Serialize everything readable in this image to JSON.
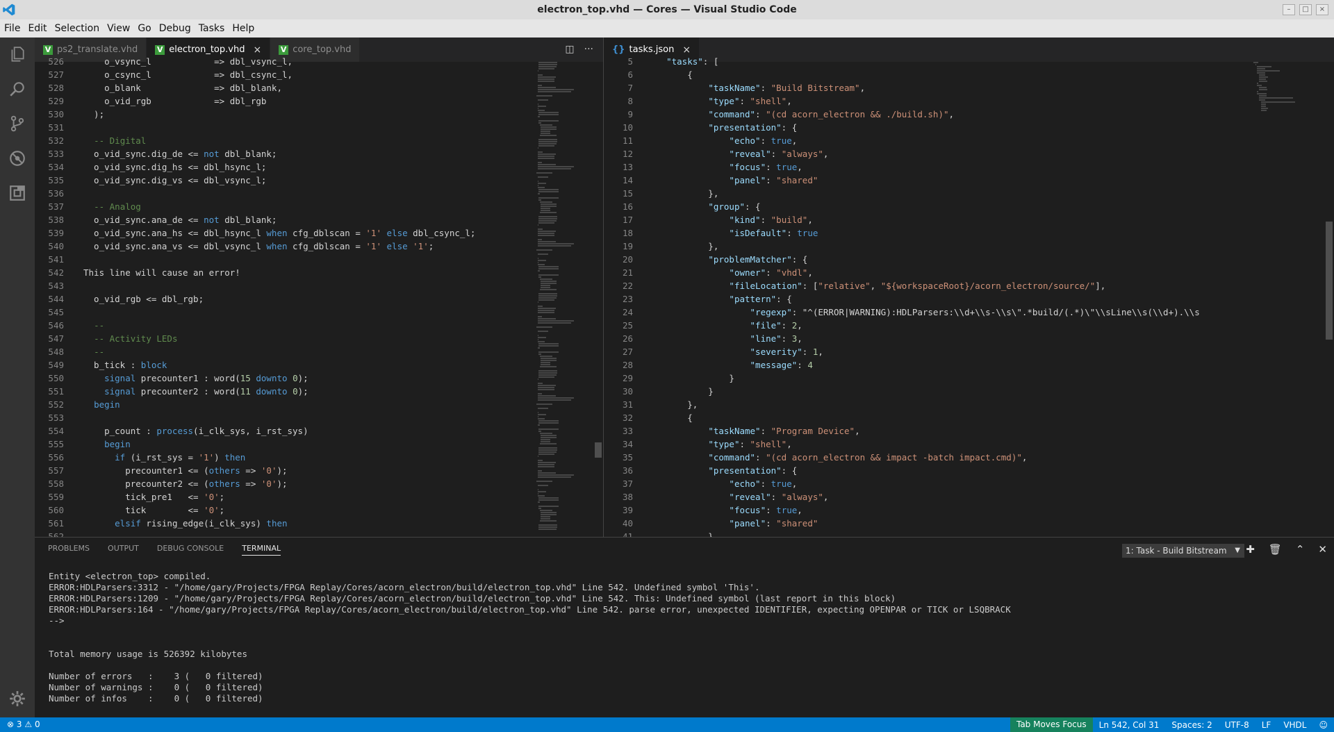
{
  "window": {
    "title": "electron_top.vhd — Cores — Visual Studio Code"
  },
  "menu": [
    "File",
    "Edit",
    "Selection",
    "View",
    "Go",
    "Debug",
    "Tasks",
    "Help"
  ],
  "activity": [
    "files-icon",
    "search-icon",
    "source-control-icon",
    "debug-icon",
    "extensions-icon"
  ],
  "left_group": {
    "tabs": [
      {
        "label": "ps2_translate.vhd",
        "active": false
      },
      {
        "label": "electron_top.vhd",
        "active": true
      },
      {
        "label": "core_top.vhd",
        "active": false
      }
    ],
    "lines": [
      {
        "n": "526",
        "t": "    o_vsync_l            => dbl_vsync_l,"
      },
      {
        "n": "527",
        "t": "    o_csync_l            => dbl_csync_l,"
      },
      {
        "n": "528",
        "t": "    o_blank              => dbl_blank,"
      },
      {
        "n": "529",
        "t": "    o_vid_rgb            => dbl_rgb"
      },
      {
        "n": "530",
        "t": "  );"
      },
      {
        "n": "531",
        "t": ""
      },
      {
        "n": "532",
        "t": "  -- Digital"
      },
      {
        "n": "533",
        "t": "  o_vid_sync.dig_de <= not dbl_blank;"
      },
      {
        "n": "534",
        "t": "  o_vid_sync.dig_hs <= dbl_hsync_l;"
      },
      {
        "n": "535",
        "t": "  o_vid_sync.dig_vs <= dbl_vsync_l;"
      },
      {
        "n": "536",
        "t": ""
      },
      {
        "n": "537",
        "t": "  -- Analog"
      },
      {
        "n": "538",
        "t": "  o_vid_sync.ana_de <= not dbl_blank;"
      },
      {
        "n": "539",
        "t": "  o_vid_sync.ana_hs <= dbl_hsync_l when cfg_dblscan = '1' else dbl_csync_l;"
      },
      {
        "n": "540",
        "t": "  o_vid_sync.ana_vs <= dbl_vsync_l when cfg_dblscan = '1' else '1';"
      },
      {
        "n": "541",
        "t": ""
      },
      {
        "n": "542",
        "t": "This line will cause an error!"
      },
      {
        "n": "543",
        "t": ""
      },
      {
        "n": "544",
        "t": "  o_vid_rgb <= dbl_rgb;"
      },
      {
        "n": "545",
        "t": ""
      },
      {
        "n": "546",
        "t": "  --"
      },
      {
        "n": "547",
        "t": "  -- Activity LEDs"
      },
      {
        "n": "548",
        "t": "  --"
      },
      {
        "n": "549",
        "t": "  b_tick : block"
      },
      {
        "n": "550",
        "t": "    signal precounter1 : word(15 downto 0);"
      },
      {
        "n": "551",
        "t": "    signal precounter2 : word(11 downto 0);"
      },
      {
        "n": "552",
        "t": "  begin"
      },
      {
        "n": "553",
        "t": ""
      },
      {
        "n": "554",
        "t": "    p_count : process(i_clk_sys, i_rst_sys)"
      },
      {
        "n": "555",
        "t": "    begin"
      },
      {
        "n": "556",
        "t": "      if (i_rst_sys = '1') then"
      },
      {
        "n": "557",
        "t": "        precounter1 <= (others => '0');"
      },
      {
        "n": "558",
        "t": "        precounter2 <= (others => '0');"
      },
      {
        "n": "559",
        "t": "        tick_pre1   <= '0';"
      },
      {
        "n": "560",
        "t": "        tick        <= '0';"
      },
      {
        "n": "561",
        "t": "      elsif rising_edge(i_clk_sys) then"
      },
      {
        "n": "562",
        "t": ""
      }
    ]
  },
  "right_group": {
    "tabs": [
      {
        "label": "tasks.json",
        "active": true
      }
    ],
    "lines": [
      {
        "n": "5",
        "t": "    \"tasks\": ["
      },
      {
        "n": "6",
        "t": "        {"
      },
      {
        "n": "7",
        "t": "            \"taskName\": \"Build Bitstream\","
      },
      {
        "n": "8",
        "t": "            \"type\": \"shell\","
      },
      {
        "n": "9",
        "t": "            \"command\": \"(cd acorn_electron && ./build.sh)\","
      },
      {
        "n": "10",
        "t": "            \"presentation\": {"
      },
      {
        "n": "11",
        "t": "                \"echo\": true,"
      },
      {
        "n": "12",
        "t": "                \"reveal\": \"always\","
      },
      {
        "n": "13",
        "t": "                \"focus\": true,"
      },
      {
        "n": "14",
        "t": "                \"panel\": \"shared\""
      },
      {
        "n": "15",
        "t": "            },"
      },
      {
        "n": "16",
        "t": "            \"group\": {"
      },
      {
        "n": "17",
        "t": "                \"kind\": \"build\","
      },
      {
        "n": "18",
        "t": "                \"isDefault\": true"
      },
      {
        "n": "19",
        "t": "            },"
      },
      {
        "n": "20",
        "t": "            \"problemMatcher\": {"
      },
      {
        "n": "21",
        "t": "                \"owner\": \"vhdl\","
      },
      {
        "n": "22",
        "t": "                \"fileLocation\": [\"relative\", \"${workspaceRoot}/acorn_electron/source/\"],"
      },
      {
        "n": "23",
        "t": "                \"pattern\": {"
      },
      {
        "n": "24",
        "t": "                    \"regexp\": \"^(ERROR|WARNING):HDLParsers:\\\\d+\\\\s-\\\\s\\\".*build/(.*)\\\"\\\\sLine\\\\s(\\\\d+).\\\\s"
      },
      {
        "n": "25",
        "t": "                    \"file\": 2,"
      },
      {
        "n": "26",
        "t": "                    \"line\": 3,"
      },
      {
        "n": "27",
        "t": "                    \"severity\": 1,"
      },
      {
        "n": "28",
        "t": "                    \"message\": 4"
      },
      {
        "n": "29",
        "t": "                }"
      },
      {
        "n": "30",
        "t": "            }"
      },
      {
        "n": "31",
        "t": "        },"
      },
      {
        "n": "32",
        "t": "        {"
      },
      {
        "n": "33",
        "t": "            \"taskName\": \"Program Device\","
      },
      {
        "n": "34",
        "t": "            \"type\": \"shell\","
      },
      {
        "n": "35",
        "t": "            \"command\": \"(cd acorn_electron && impact -batch impact.cmd)\","
      },
      {
        "n": "36",
        "t": "            \"presentation\": {"
      },
      {
        "n": "37",
        "t": "                \"echo\": true,"
      },
      {
        "n": "38",
        "t": "                \"reveal\": \"always\","
      },
      {
        "n": "39",
        "t": "                \"focus\": true,"
      },
      {
        "n": "40",
        "t": "                \"panel\": \"shared\""
      },
      {
        "n": "41",
        "t": "            }"
      }
    ]
  },
  "panel": {
    "tabs": [
      "PROBLEMS",
      "OUTPUT",
      "DEBUG CONSOLE",
      "TERMINAL"
    ],
    "active_tab": "TERMINAL",
    "terminal_select": "1: Task - Build Bitstream",
    "terminal_lines": [
      "Entity <electron_top> compiled.",
      "ERROR:HDLParsers:3312 - \"/home/gary/Projects/FPGA Replay/Cores/acorn_electron/build/electron_top.vhd\" Line 542. Undefined symbol 'This'.",
      "ERROR:HDLParsers:1209 - \"/home/gary/Projects/FPGA Replay/Cores/acorn_electron/build/electron_top.vhd\" Line 542. This: Undefined symbol (last report in this block)",
      "ERROR:HDLParsers:164 - \"/home/gary/Projects/FPGA Replay/Cores/acorn_electron/build/electron_top.vhd\" Line 542. parse error, unexpected IDENTIFIER, expecting OPENPAR or TICK or LSQBRACK",
      "-->",
      "",
      "",
      "Total memory usage is 526392 kilobytes",
      "",
      "Number of errors   :    3 (   0 filtered)",
      "Number of warnings :    0 (   0 filtered)",
      "Number of infos    :    0 (   0 filtered)"
    ]
  },
  "status": {
    "errors": "3",
    "warnings": "0",
    "tab_focus": "Tab Moves Focus",
    "position": "Ln 542, Col 31",
    "spaces": "Spaces: 2",
    "encoding": "UTF-8",
    "eol": "LF",
    "language": "VHDL"
  },
  "colors": {
    "accent": "#007acc",
    "editor_bg": "#1e1e1e",
    "activity_bg": "#333333",
    "keyword": "#569cd6",
    "string": "#ce9178",
    "comment": "#608b4e",
    "json_key": "#9cdcfe"
  }
}
